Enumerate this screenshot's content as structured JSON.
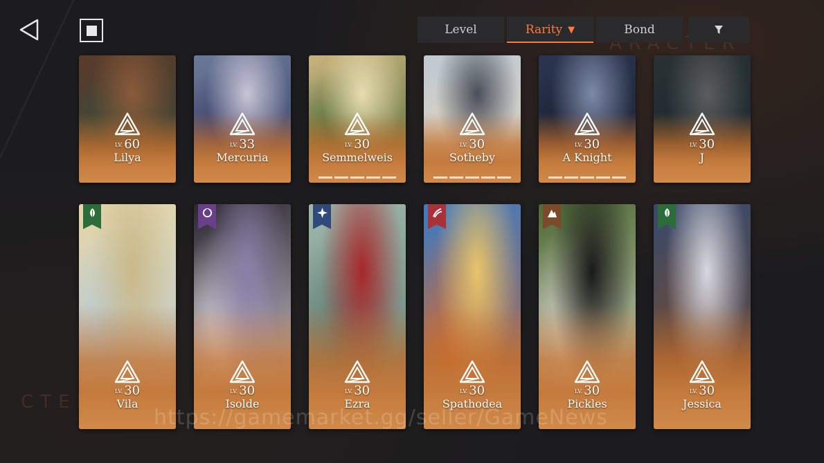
{
  "header": {
    "back_icon": "back-triangle-icon",
    "stop_icon": "stop-square-icon"
  },
  "sort": {
    "tabs": [
      {
        "label": "Level",
        "active": false
      },
      {
        "label": "Rarity",
        "active": true,
        "indicator": "▼"
      },
      {
        "label": "Bond",
        "active": false
      }
    ],
    "filter_icon": "filter-funnel-icon"
  },
  "background": {
    "text_top": "ARACTER",
    "text_left": "CTER×"
  },
  "lv_tag": "LV.",
  "row1": [
    {
      "name": "Lilya",
      "level": "60",
      "art": [
        "#5a3a2a",
        "#8a5a3a",
        "#3a4a3a"
      ]
    },
    {
      "name": "Mercuria",
      "level": "33",
      "art": [
        "#6b7a98",
        "#c7c4d6",
        "#3c3f6a"
      ]
    },
    {
      "name": "Semmelweis",
      "level": "30",
      "art": [
        "#c9b37d",
        "#e8dcb0",
        "#4d6b3a"
      ],
      "pips": 5
    },
    {
      "name": "Sotheby",
      "level": "30",
      "art": [
        "#bfc9d2",
        "#4a4f5a",
        "#d9d2c2"
      ],
      "pips": 5
    },
    {
      "name": "A Knight",
      "level": "30",
      "art": [
        "#2b3550",
        "#7c8aa8",
        "#1c2233"
      ],
      "pips": 5
    },
    {
      "name": "J",
      "level": "30",
      "art": [
        "#2a3034",
        "#5b5d5f",
        "#1d2a2f"
      ]
    }
  ],
  "row2": [
    {
      "name": "Vila",
      "level": "30",
      "element": "leaf-icon",
      "tag_color": "#2c6b3a",
      "art": [
        "#e6d6a8",
        "#c9b98a",
        "#b4c8d8"
      ]
    },
    {
      "name": "Isolde",
      "level": "30",
      "element": "moon-icon",
      "tag_color": "#6a3f8a",
      "art": [
        "#2a2630",
        "#8a7fa8",
        "#e3e1ea"
      ]
    },
    {
      "name": "Ezra",
      "level": "30",
      "element": "star-icon",
      "tag_color": "#2f4a78",
      "art": [
        "#9fb8ad",
        "#a8282a",
        "#5d7a72"
      ]
    },
    {
      "name": "Spathodea",
      "level": "30",
      "element": "flame-icon",
      "tag_color": "#a8323a",
      "art": [
        "#3f7ac0",
        "#e8c46a",
        "#c86a3a"
      ]
    },
    {
      "name": "Pickles",
      "level": "30",
      "element": "mountain-icon",
      "tag_color": "#7a4a2a",
      "art": [
        "#4f6a34",
        "#1a1a1a",
        "#d8d6cf"
      ]
    },
    {
      "name": "Jessica",
      "level": "30",
      "element": "leaf-icon",
      "tag_color": "#2c6b3a",
      "art": [
        "#3a4a6a",
        "#d8d8e0",
        "#6a4a3a"
      ]
    }
  ],
  "watermark": "https://gamemarket.gg/seller/GameNews"
}
